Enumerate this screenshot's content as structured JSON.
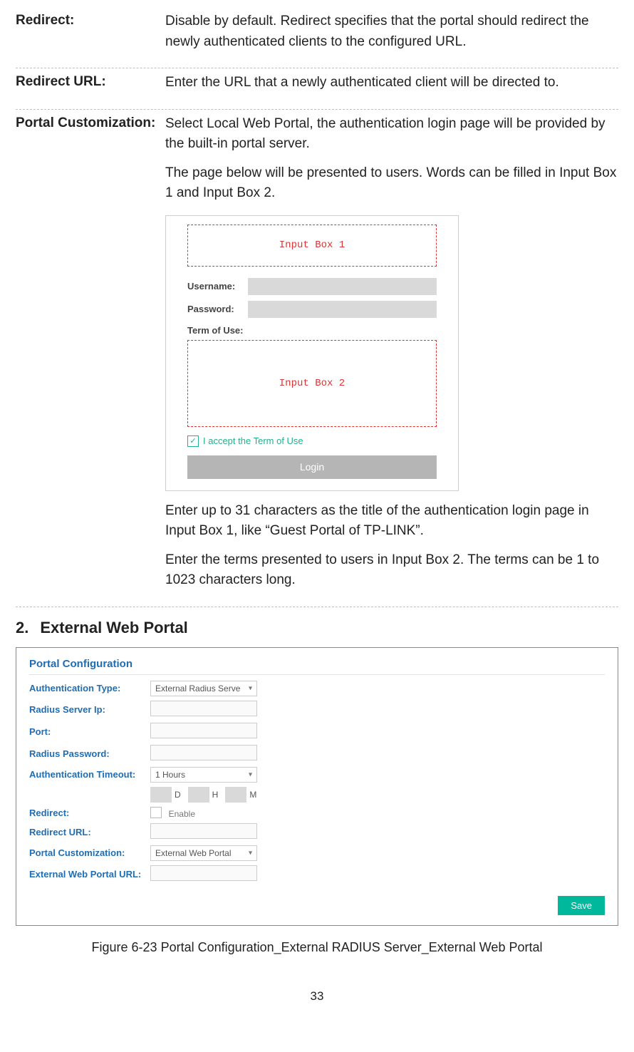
{
  "defs": {
    "redirect": {
      "term": "Redirect:",
      "desc": "Disable by default. Redirect specifies that the portal should redirect the newly authenticated clients to the configured URL."
    },
    "redirect_url": {
      "term": "Redirect URL:",
      "desc": "Enter the URL that a newly authenticated client will be directed to."
    },
    "portal_custom": {
      "term": "Portal Customization:",
      "p1": "Select Local Web Portal, the authentication login page will be provided by the built-in portal server.",
      "p2": "The page below will be presented to users. Words can be filled in Input Box 1 and Input Box 2.",
      "p3": "Enter up to 31 characters as the title of the authentication login page in Input Box 1, like “Guest Portal of TP-LINK”.",
      "p4": "Enter the terms presented to users in Input Box 2. The terms can be 1 to 1023 characters long."
    }
  },
  "preview": {
    "input1": "Input Box 1",
    "username_lbl": "Username:",
    "password_lbl": "Password:",
    "terms_lbl": "Term of Use:",
    "input2": "Input Box 2",
    "accept_text": "I accept the Term of Use",
    "login": "Login"
  },
  "section": {
    "num": "2.",
    "title": "External Web Portal"
  },
  "cfg": {
    "panel_title": "Portal Configuration",
    "auth_type_lbl": "Authentication Type:",
    "auth_type_val": "External Radius Serve",
    "radius_ip_lbl": "Radius Server Ip:",
    "port_lbl": "Port:",
    "radius_pwd_lbl": "Radius Password:",
    "auth_timeout_lbl": "Authentication Timeout:",
    "auth_timeout_val": "1 Hours",
    "unit_d": "D",
    "unit_h": "H",
    "unit_m": "M",
    "redirect_lbl": "Redirect:",
    "redirect_enable": "Enable",
    "redirect_url_lbl": "Redirect URL:",
    "portal_custom_lbl": "Portal Customization:",
    "portal_custom_val": "External Web Portal",
    "ext_url_lbl": "External Web Portal URL:",
    "save": "Save"
  },
  "figure_caption": "Figure 6-23 Portal Configuration_External RADIUS Server_External Web Portal",
  "page_number": "33"
}
